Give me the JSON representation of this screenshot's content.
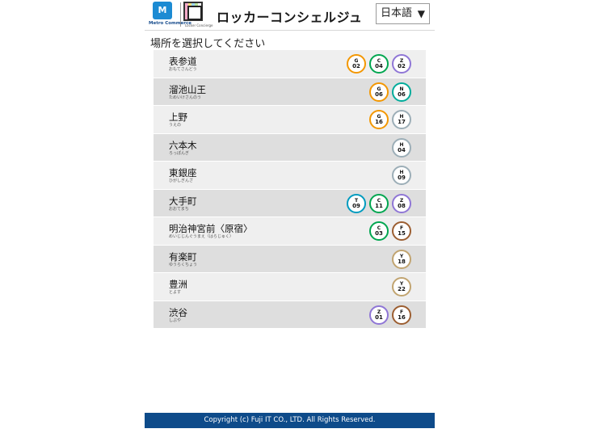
{
  "header": {
    "metro_logo_text": "Metro Commerce",
    "locker_logo_text": "Locker Concierge",
    "title": "ロッカーコンシェルジュ",
    "language": "日本語",
    "language_arrow": "▼"
  },
  "prompt": "場所を選択してください",
  "stations": [
    {
      "name": "表参道",
      "kana": "おもてさんどう",
      "lines": [
        {
          "letter": "G",
          "num": "02",
          "color": "#f39700"
        },
        {
          "letter": "C",
          "num": "04",
          "color": "#00a650"
        },
        {
          "letter": "Z",
          "num": "02",
          "color": "#8f76d6"
        }
      ]
    },
    {
      "name": "溜池山王",
      "kana": "ためいけさんのう",
      "lines": [
        {
          "letter": "G",
          "num": "06",
          "color": "#f39700"
        },
        {
          "letter": "N",
          "num": "06",
          "color": "#00ac9b"
        }
      ]
    },
    {
      "name": "上野",
      "kana": "うえの",
      "lines": [
        {
          "letter": "G",
          "num": "16",
          "color": "#f39700"
        },
        {
          "letter": "H",
          "num": "17",
          "color": "#9caeb7"
        }
      ]
    },
    {
      "name": "六本木",
      "kana": "ろっぽんぎ",
      "lines": [
        {
          "letter": "H",
          "num": "04",
          "color": "#9caeb7"
        }
      ]
    },
    {
      "name": "東銀座",
      "kana": "ひがしぎんざ",
      "lines": [
        {
          "letter": "H",
          "num": "09",
          "color": "#9caeb7"
        }
      ]
    },
    {
      "name": "大手町",
      "kana": "おおてまち",
      "lines": [
        {
          "letter": "T",
          "num": "09",
          "color": "#009bbf"
        },
        {
          "letter": "C",
          "num": "11",
          "color": "#00a650"
        },
        {
          "letter": "Z",
          "num": "08",
          "color": "#8f76d6"
        }
      ]
    },
    {
      "name": "明治神宮前〈原宿〉",
      "kana": "めいじじんぐうまえ〈はらじゅく〉",
      "lines": [
        {
          "letter": "C",
          "num": "03",
          "color": "#00a650"
        },
        {
          "letter": "F",
          "num": "15",
          "color": "#9c5e31"
        }
      ]
    },
    {
      "name": "有楽町",
      "kana": "ゆうらくちょう",
      "lines": [
        {
          "letter": "Y",
          "num": "18",
          "color": "#c1a470"
        }
      ]
    },
    {
      "name": "豊洲",
      "kana": "とよす",
      "lines": [
        {
          "letter": "Y",
          "num": "22",
          "color": "#c1a470"
        }
      ]
    },
    {
      "name": "渋谷",
      "kana": "しぶや",
      "lines": [
        {
          "letter": "Z",
          "num": "01",
          "color": "#8f76d6"
        },
        {
          "letter": "F",
          "num": "16",
          "color": "#9c5e31"
        }
      ]
    }
  ],
  "footer": "Copyright (c) Fuji IT CO., LTD. All Rights Reserved."
}
